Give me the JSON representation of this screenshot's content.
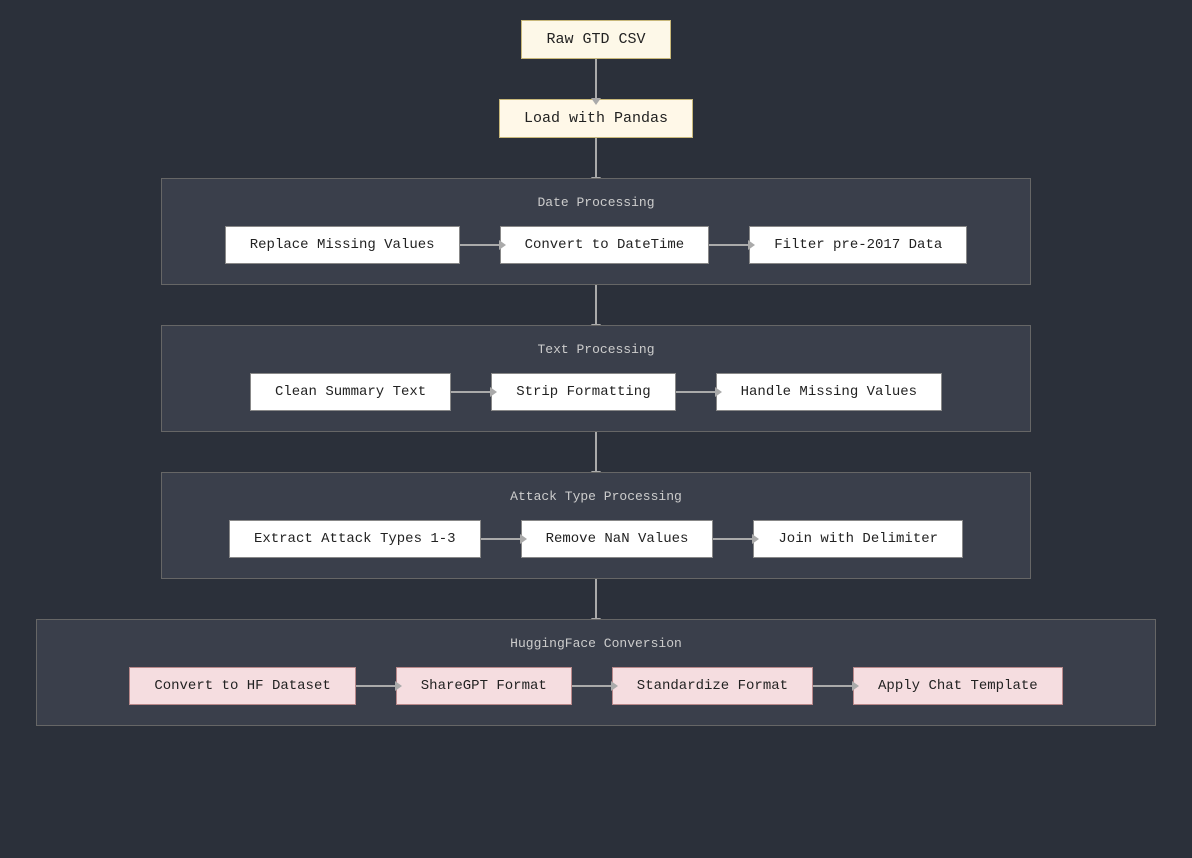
{
  "nodes": {
    "raw_csv": "Raw GTD CSV",
    "load_pandas": "Load with Pandas"
  },
  "groups": {
    "date_processing": {
      "title": "Date Processing",
      "steps": [
        "Replace Missing Values",
        "Convert to DateTime",
        "Filter pre-2017 Data"
      ]
    },
    "text_processing": {
      "title": "Text Processing",
      "steps": [
        "Clean Summary Text",
        "Strip Formatting",
        "Handle Missing Values"
      ]
    },
    "attack_type_processing": {
      "title": "Attack Type Processing",
      "steps": [
        "Extract Attack Types 1-3",
        "Remove NaN Values",
        "Join with Delimiter"
      ]
    },
    "huggingface_conversion": {
      "title": "HuggingFace Conversion",
      "steps": [
        "Convert to HF Dataset",
        "ShareGPT Format",
        "Standardize Format",
        "Apply Chat Template"
      ]
    }
  }
}
